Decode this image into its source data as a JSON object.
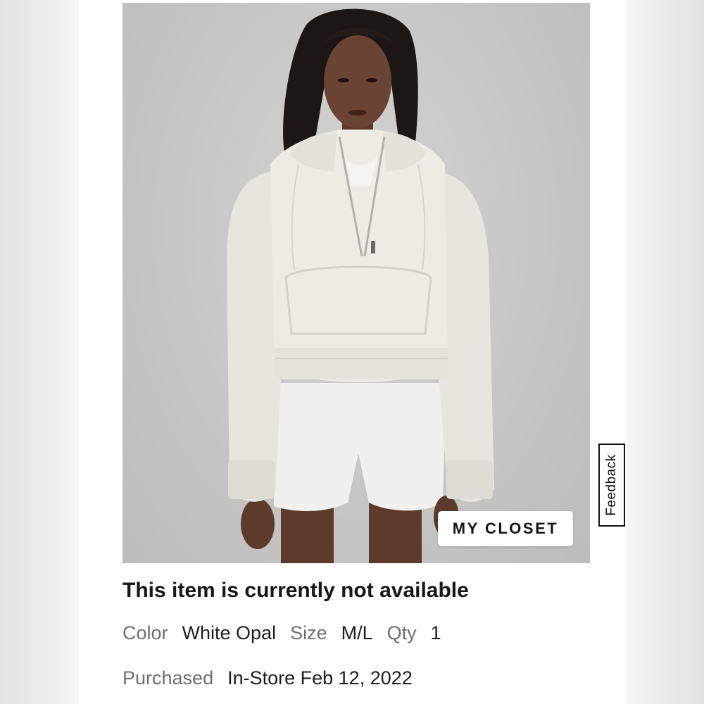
{
  "product": {
    "image_alt": "Woman wearing a white opal cropped half-zip hoodie and white bike shorts",
    "my_closet_label": "MY CLOSET",
    "availability_text": "This item is currently not available",
    "details": {
      "color_label": "Color",
      "color_value": "White Opal",
      "size_label": "Size",
      "size_value": "M/L",
      "qty_label": "Qty",
      "qty_value": "1"
    },
    "purchase": {
      "purchased_label": "Purchased",
      "purchased_value": "In-Store Feb 12, 2022"
    }
  },
  "feedback": {
    "label": "Feedback"
  },
  "colors": {
    "photo_background": "#c6c6c6",
    "garment": "#ecebe4",
    "text_primary": "#171717",
    "text_secondary": "#6f6f6f"
  }
}
